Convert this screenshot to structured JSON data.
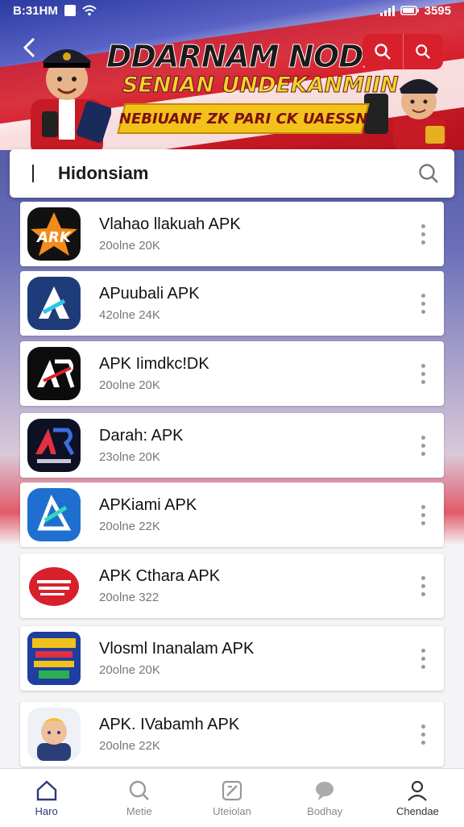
{
  "status_bar": {
    "time": "B:31HM",
    "right_text": "3595"
  },
  "banner": {
    "title": "DDARNAM NODISI",
    "subtitle": "SENIAN UNDEKANMIIN",
    "ribbon": "NEBIUANF ZK PARI CK UAESSN"
  },
  "search": {
    "value": "Hidonsiam"
  },
  "apps": [
    {
      "name": "Vlahao llakuah APK",
      "sub": "20olne 20K",
      "icon": "ark-icon"
    },
    {
      "name": "APuubali APK",
      "sub": "42olne 24K",
      "icon": "a-blue-icon"
    },
    {
      "name": "APK Iimdkc!DK",
      "sub": "20olne 20K",
      "icon": "ar-black-icon"
    },
    {
      "name": "Darah: APK",
      "sub": "23olne 20K",
      "icon": "ar-dark-icon"
    },
    {
      "name": "APKiami APK",
      "sub": "20olne 22K",
      "icon": "a-outline-icon"
    },
    {
      "name": "APK Cthara APK",
      "sub": "20olne 322",
      "icon": "red-badge-icon"
    },
    {
      "name": "Vlosml Inanalam APK",
      "sub": "20olne 20K",
      "icon": "game-poster-icon"
    },
    {
      "name": "APK. IVabamh APK",
      "sub": "20olne 22K",
      "icon": "avatar-icon"
    }
  ],
  "nav": [
    {
      "label": "Haro",
      "icon": "home-icon"
    },
    {
      "label": "Metie",
      "icon": "search-icon"
    },
    {
      "label": "Uteiolan",
      "icon": "edit-icon"
    },
    {
      "label": "Bodhay",
      "icon": "chat-icon"
    },
    {
      "label": "Chendae",
      "icon": "profile-icon"
    }
  ],
  "colors": {
    "brand_red": "#d8202d",
    "accent_blue": "#2a3a7a"
  }
}
